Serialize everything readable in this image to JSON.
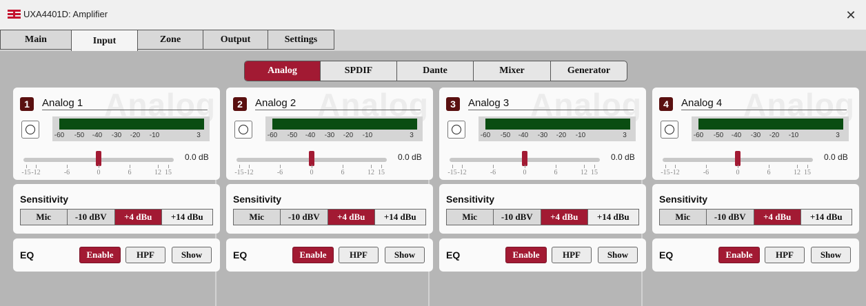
{
  "window": {
    "title": "UXA4401D: Amplifier",
    "close_glyph": "✕"
  },
  "tabs": [
    "Main",
    "Input",
    "Zone",
    "Output",
    "Settings"
  ],
  "active_tab": "Input",
  "subtabs": [
    "Analog",
    "SPDIF",
    "Dante",
    "Mixer",
    "Generator"
  ],
  "active_subtab": "Analog",
  "watermark": "Analog",
  "meter_scale": [
    "-60",
    "-50",
    "-40",
    "-30",
    "-20",
    "-10",
    "3"
  ],
  "slider_ticks": [
    "-15",
    "-12",
    "-6",
    "0",
    "6",
    "12",
    "15"
  ],
  "sensitivity_label": "Sensitivity",
  "sensitivity_options": [
    "Mic",
    "-10 dBV",
    "+4 dBu",
    "+14 dBu"
  ],
  "eq_label": "EQ",
  "eq_buttons": [
    "Enable",
    "HPF",
    "Show"
  ],
  "colors": {
    "accent": "#a21a33",
    "meter_green": "#0a4d12",
    "badge": "#5a1010"
  },
  "channels": [
    {
      "number": "1",
      "name": "Analog 1",
      "gain": "0.0 dB",
      "sensitivity": "+4 dBu",
      "eq_enabled": true
    },
    {
      "number": "2",
      "name": "Analog 2",
      "gain": "0.0 dB",
      "sensitivity": "+4 dBu",
      "eq_enabled": true
    },
    {
      "number": "3",
      "name": "Analog 3",
      "gain": "0.0 dB",
      "sensitivity": "+4 dBu",
      "eq_enabled": true
    },
    {
      "number": "4",
      "name": "Analog 4",
      "gain": "0.0 dB",
      "sensitivity": "+4 dBu",
      "eq_enabled": true
    }
  ]
}
